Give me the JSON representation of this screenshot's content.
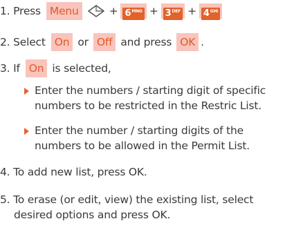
{
  "step1": {
    "prefix": "1. Press",
    "menu_key": "Menu",
    "plus": "+",
    "key6": {
      "digit": "6",
      "letters": "MNO"
    },
    "key3": {
      "digit": "3",
      "letters": "DEF"
    },
    "key4": {
      "digit": "4",
      "letters": "GHI"
    }
  },
  "step2": {
    "prefix": "2. Select",
    "on": "On",
    "or": "or",
    "off": "Off",
    "and_press": "and press",
    "ok": "OK",
    "period": "."
  },
  "step3": {
    "prefix": "3. If",
    "on": "On",
    "suffix": "is selected,"
  },
  "bullet1": {
    "line1": "Enter the numbers / starting digit of specific",
    "line2": "numbers to be restricted in the Restric List."
  },
  "bullet2": {
    "line1": "Enter the number / starting digits of the",
    "line2": "numbers to be allowed in the Permit List."
  },
  "step4": "4. To add new list, press OK.",
  "step5": {
    "line1": "5. To erase (or edit, view) the existing list, select",
    "line2": "desired options and press OK."
  },
  "colors": {
    "accent": "#e35a24",
    "highlight": "#f8c4bd",
    "key_fill": "#e2622a",
    "text": "#3a3a3a"
  },
  "icons": [
    "navigation-key-icon",
    "bullet-triangle-icon"
  ]
}
